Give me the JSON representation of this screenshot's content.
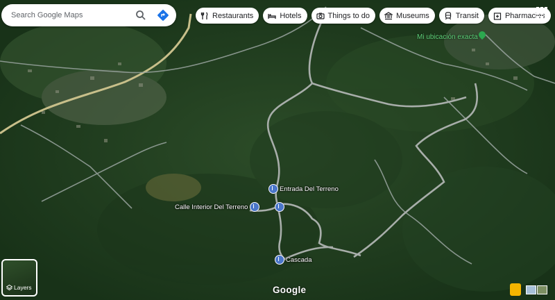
{
  "search": {
    "placeholder": "Search Google Maps"
  },
  "categories": [
    {
      "label": "Restaurants",
      "icon": "fork-knife-icon"
    },
    {
      "label": "Hotels",
      "icon": "bed-icon"
    },
    {
      "label": "Things to do",
      "icon": "camera-icon"
    },
    {
      "label": "Museums",
      "icon": "museum-icon"
    },
    {
      "label": "Transit",
      "icon": "train-icon"
    },
    {
      "label": "Pharmacies",
      "icon": "pharmacy-icon"
    }
  ],
  "map": {
    "markers": {
      "entrada": "Entrada Del Terreno",
      "calle": "Calle Interior Del Terreno",
      "cascada": "Cascada"
    },
    "my_location": "Mi ubicación exacta"
  },
  "layers": {
    "label": "Layers"
  },
  "brand": "Google",
  "colors": {
    "marker": "#4a76c9",
    "route": "#9aa5a0",
    "my_location": "#2ca84f"
  }
}
